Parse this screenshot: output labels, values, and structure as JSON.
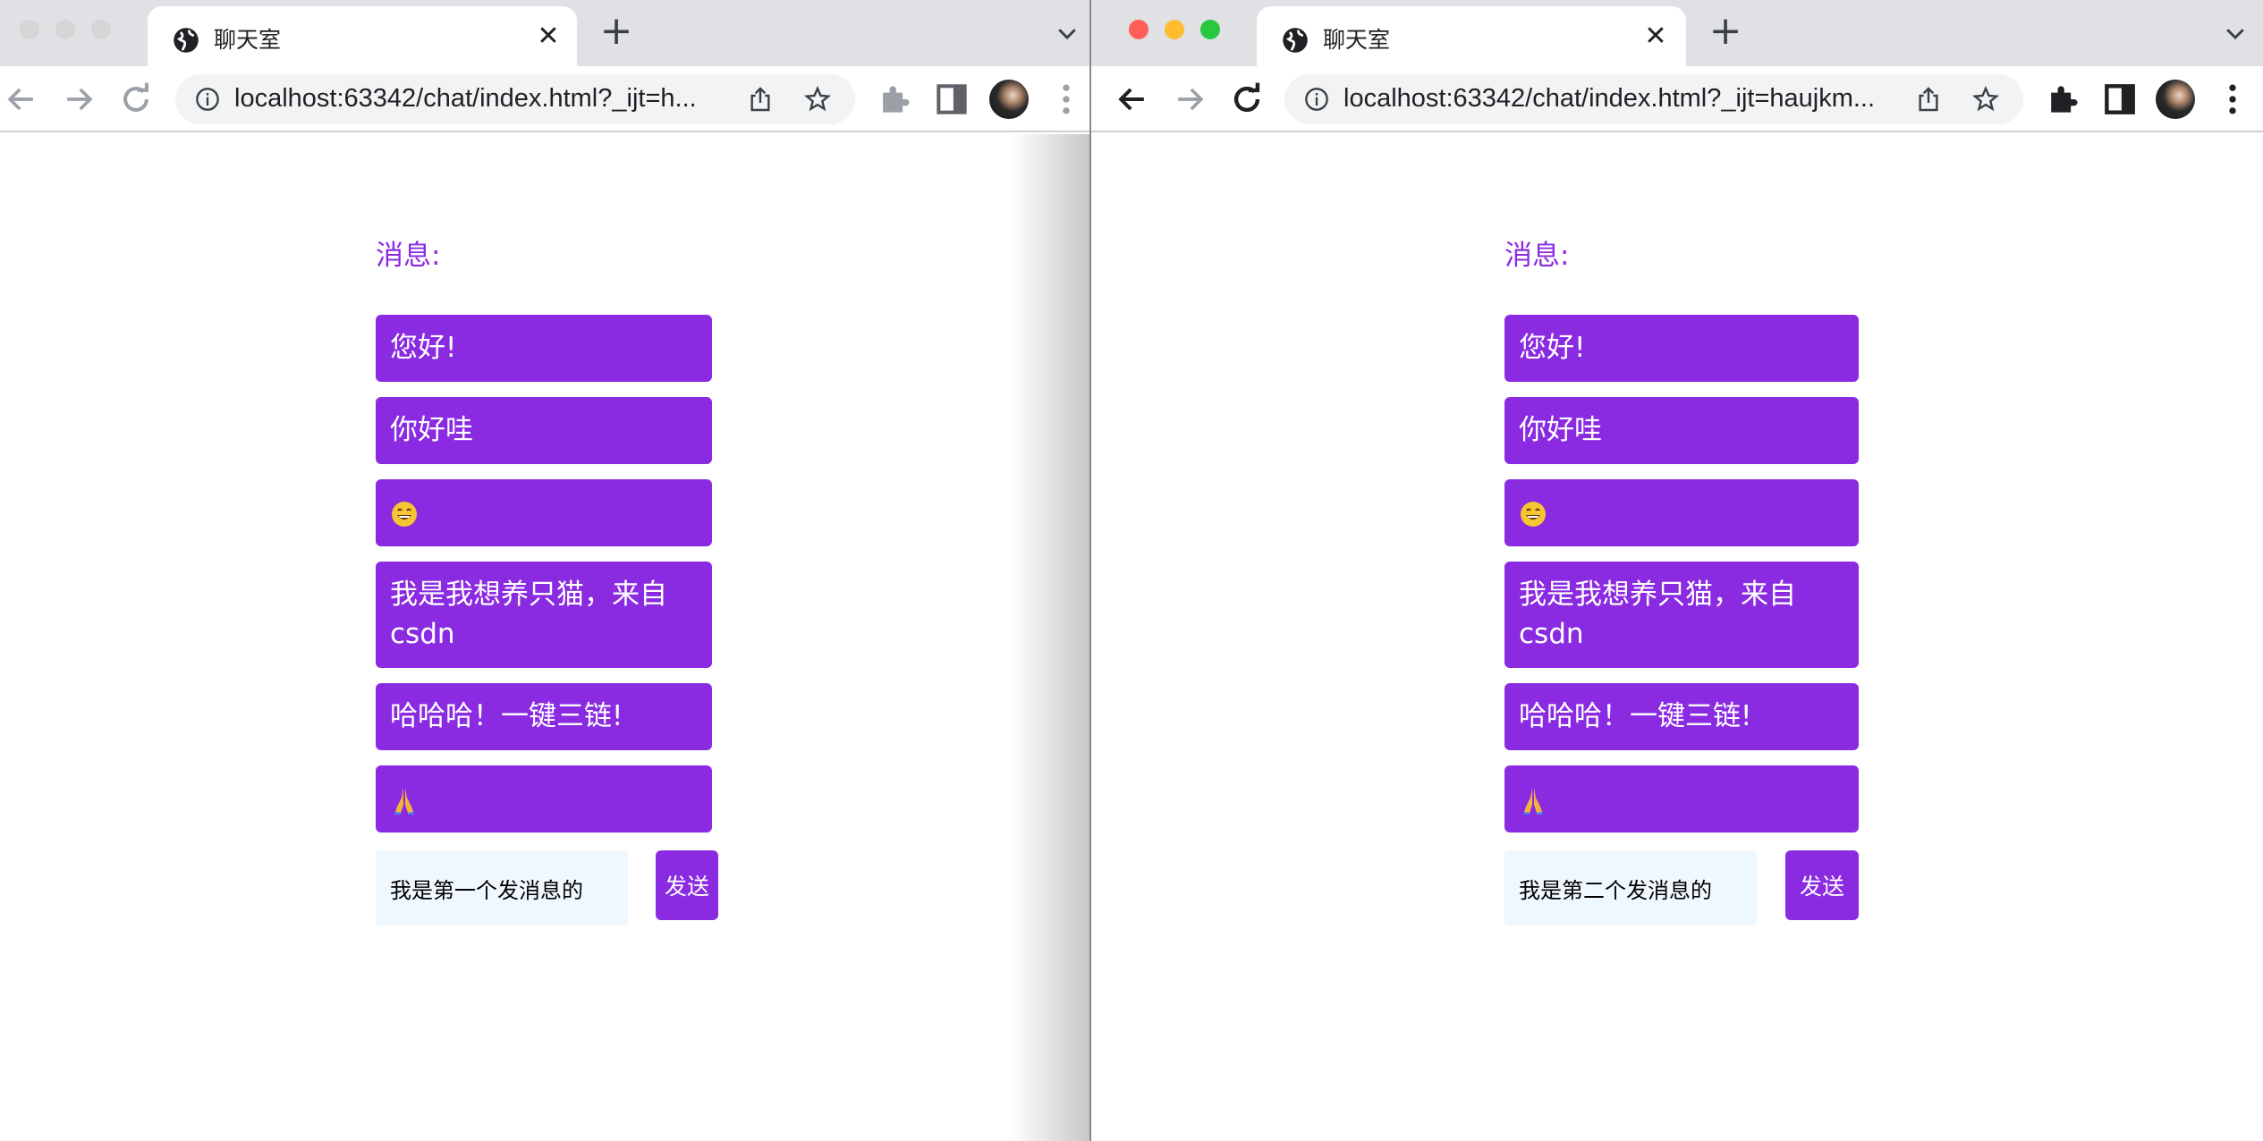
{
  "colors": {
    "accent": "#8a2be2",
    "input_bg": "#f0f8ff",
    "tabstrip": "#dfe1e5"
  },
  "windows": [
    {
      "tab": {
        "title": "聊天室"
      },
      "address_bar": {
        "url": "localhost:63342/chat/index.html?_ijt=h..."
      },
      "page": {
        "heading": "消息:",
        "messages": [
          {
            "text": "您好!"
          },
          {
            "text": "你好哇"
          },
          {
            "text": "",
            "icon": "grinning-face-emoji"
          },
          {
            "text": "我是我想养只猫，来自csdn"
          },
          {
            "text": "哈哈哈！一键三链!"
          },
          {
            "text": "",
            "icon": "folded-hands-emoji"
          }
        ],
        "input_value": "我是第一个发消息的",
        "send_label": "发送"
      }
    },
    {
      "tab": {
        "title": "聊天室"
      },
      "address_bar": {
        "url": "localhost:63342/chat/index.html?_ijt=haujkm..."
      },
      "page": {
        "heading": "消息:",
        "messages": [
          {
            "text": "您好!"
          },
          {
            "text": "你好哇"
          },
          {
            "text": "",
            "icon": "grinning-face-emoji"
          },
          {
            "text": "我是我想养只猫，来自csdn"
          },
          {
            "text": "哈哈哈！一键三链!"
          },
          {
            "text": "",
            "icon": "folded-hands-emoji"
          }
        ],
        "input_value": "我是第二个发消息的",
        "send_label": "发送"
      }
    }
  ]
}
